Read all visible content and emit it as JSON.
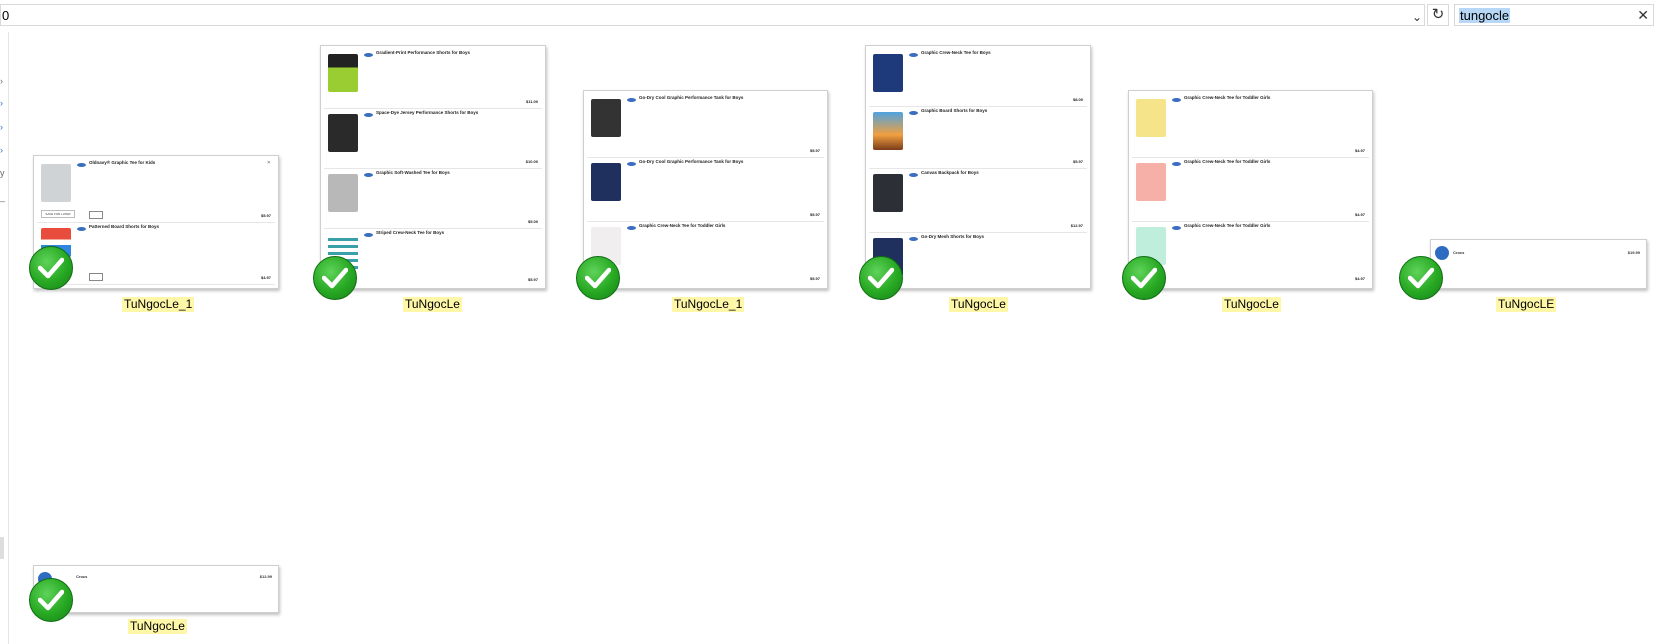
{
  "address_bar": {
    "value": "0"
  },
  "search": {
    "value": "tungocle"
  },
  "icons": {
    "dropdown": "chevron-down-icon",
    "refresh": "refresh-icon",
    "clear": "close-icon",
    "check": "checkmark-icon"
  },
  "colors": {
    "highlight": "#fff7a8",
    "selection": "#b6d7f5",
    "check": "#27a822"
  },
  "files": [
    {
      "caption": "TuNgocLe_1"
    },
    {
      "caption": "TuNgocLe"
    },
    {
      "caption": "TuNgocLe_1"
    },
    {
      "caption": "TuNgocLe"
    },
    {
      "caption": "TuNgocLe"
    },
    {
      "caption": "TuNgocLE"
    },
    {
      "caption": "TuNgocLe"
    }
  ],
  "thumb_rows": {
    "t1": [
      {
        "name": "Oldnavy® Graphic Tee for Kids",
        "price": "$5.97"
      },
      {
        "name": "Patterned Board Shorts for Boys",
        "price": "$4.97"
      }
    ],
    "t2": [
      {
        "name": "Gradient-Print Performance Shorts for Boys",
        "price": "$11.00"
      },
      {
        "name": "Space-Dye Jersey Performance Shorts for Boys",
        "price": "$10.00"
      },
      {
        "name": "Graphic Soft-Washed Tee for Boys",
        "price": "$5.00"
      },
      {
        "name": "Striped Crew-Neck Tee for Boys",
        "price": "$5.97"
      }
    ],
    "t3": [
      {
        "name": "Go-Dry Cool Graphic Performance Tank for Boys",
        "price": "$5.97"
      },
      {
        "name": "Go-Dry Cool Graphic Performance Tank for Boys",
        "price": "$5.97"
      },
      {
        "name": "Graphic Crew-Neck Tee for Toddler Girls",
        "price": "$5.97"
      }
    ],
    "t4": [
      {
        "name": "Graphic Crew-Neck Tee for Boys",
        "price": "$8.00"
      },
      {
        "name": "Graphic Board Shorts for Boys",
        "price": "$5.97"
      },
      {
        "name": "Canvas Backpack for Boys",
        "price": "$12.97"
      },
      {
        "name": "Go-Dry Mesh Shorts for Boys",
        "price": ""
      }
    ],
    "t5": [
      {
        "name": "Graphic Crew-Neck Tee for Toddler Girls",
        "price": "$4.97"
      },
      {
        "name": "Graphic Crew-Neck Tee for Toddler Girls",
        "price": "$4.97"
      },
      {
        "name": "Graphic Crew-Neck Tee for Toddler Girls",
        "price": "$4.97"
      }
    ],
    "t6": {
      "brand": "Crocs",
      "price": "$19.99"
    },
    "t7": {
      "brand": "Crocs",
      "price": "$12.99"
    }
  }
}
